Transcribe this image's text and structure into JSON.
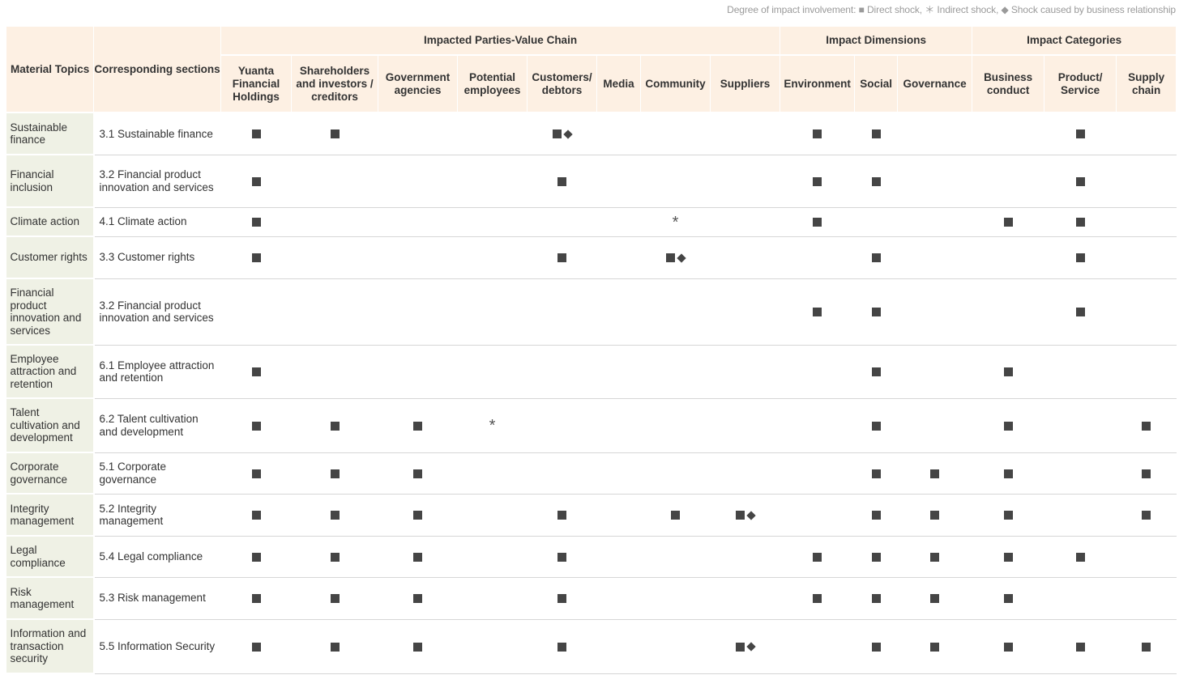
{
  "legend": {
    "prefix": "Degree of impact involvement: ",
    "direct_symbol": "■",
    "direct_label": " Direct shock, ",
    "indirect_symbol": "＊",
    "indirect_label": " Indirect shock, ",
    "business_symbol": "◆",
    "business_label": " Shock caused by business relationship"
  },
  "header": {
    "material_topics": "Material Topics",
    "corresponding_sections": "Corresponding sections",
    "groups": [
      {
        "label": "Impacted Parties-Value Chain",
        "span": 8
      },
      {
        "label": "Impact Dimensions",
        "span": 3
      },
      {
        "label": "Impact Categories",
        "span": 3
      }
    ],
    "columns": [
      "Yuanta Financial Holdings",
      "Shareholders and investors / creditors",
      "Government agencies",
      "Potential employees",
      "Customers/ debtors",
      "Media",
      "Community",
      "Suppliers",
      "Environment",
      "Social",
      "Governance",
      "Business conduct",
      "Product/ Service",
      "Supply chain"
    ]
  },
  "rows": [
    {
      "topic": "Sustainable finance",
      "section": "3.1 Sustainable finance",
      "marks": [
        "D",
        "D",
        "",
        "",
        "DB",
        "",
        "",
        "",
        "D",
        "D",
        "",
        "",
        "D",
        ""
      ]
    },
    {
      "topic": "Financial inclusion",
      "section": "3.2 Financial product innovation and services",
      "marks": [
        "D",
        "",
        "",
        "",
        "D",
        "",
        "",
        "",
        "D",
        "D",
        "",
        "",
        "D",
        ""
      ]
    },
    {
      "topic": "Climate action",
      "section": "4.1 Climate action",
      "marks": [
        "D",
        "",
        "",
        "",
        "",
        "",
        "I",
        "",
        "D",
        "",
        "",
        "D",
        "D",
        ""
      ]
    },
    {
      "topic": "Customer rights",
      "section": "3.3 Customer rights",
      "marks": [
        "D",
        "",
        "",
        "",
        "D",
        "",
        "DB",
        "",
        "",
        "D",
        "",
        "",
        "D",
        ""
      ]
    },
    {
      "topic": "Financial product innovation and services",
      "section": "3.2 Financial product innovation and services",
      "marks": [
        "",
        "",
        "",
        "",
        "",
        "",
        "",
        "",
        "D",
        "D",
        "",
        "",
        "D",
        ""
      ]
    },
    {
      "topic": "Employee attraction and retention",
      "section": "6.1 Employee attraction and retention",
      "marks": [
        "D",
        "",
        "",
        "",
        "",
        "",
        "",
        "",
        "",
        "D",
        "",
        "D",
        "",
        ""
      ]
    },
    {
      "topic": "Talent cultivation and development",
      "section": "6.2 Talent cultivation and development",
      "marks": [
        "D",
        "D",
        "D",
        "I",
        "",
        "",
        "",
        "",
        "",
        "D",
        "",
        "D",
        "",
        "D"
      ]
    },
    {
      "topic": "Corporate governance",
      "section": "5.1 Corporate governance",
      "marks": [
        "D",
        "D",
        "D",
        "",
        "",
        "",
        "",
        "",
        "",
        "D",
        "D",
        "D",
        "",
        "D"
      ]
    },
    {
      "topic": "Integrity management",
      "section": "5.2 Integrity management",
      "marks": [
        "D",
        "D",
        "D",
        "",
        "D",
        "",
        "D",
        "DB",
        "",
        "D",
        "D",
        "D",
        "",
        "D"
      ]
    },
    {
      "topic": "Legal compliance",
      "section": "5.4 Legal compliance",
      "marks": [
        "D",
        "D",
        "D",
        "",
        "D",
        "",
        "",
        "",
        "D",
        "D",
        "D",
        "D",
        "D",
        ""
      ]
    },
    {
      "topic": "Risk management",
      "section": "5.3 Risk management",
      "marks": [
        "D",
        "D",
        "D",
        "",
        "D",
        "",
        "",
        "",
        "D",
        "D",
        "D",
        "D",
        "",
        ""
      ]
    },
    {
      "topic": "Information and transaction security",
      "section": "5.5 Information Security",
      "marks": [
        "D",
        "D",
        "D",
        "",
        "D",
        "",
        "",
        "DB",
        "",
        "D",
        "D",
        "D",
        "D",
        "D"
      ]
    }
  ]
}
